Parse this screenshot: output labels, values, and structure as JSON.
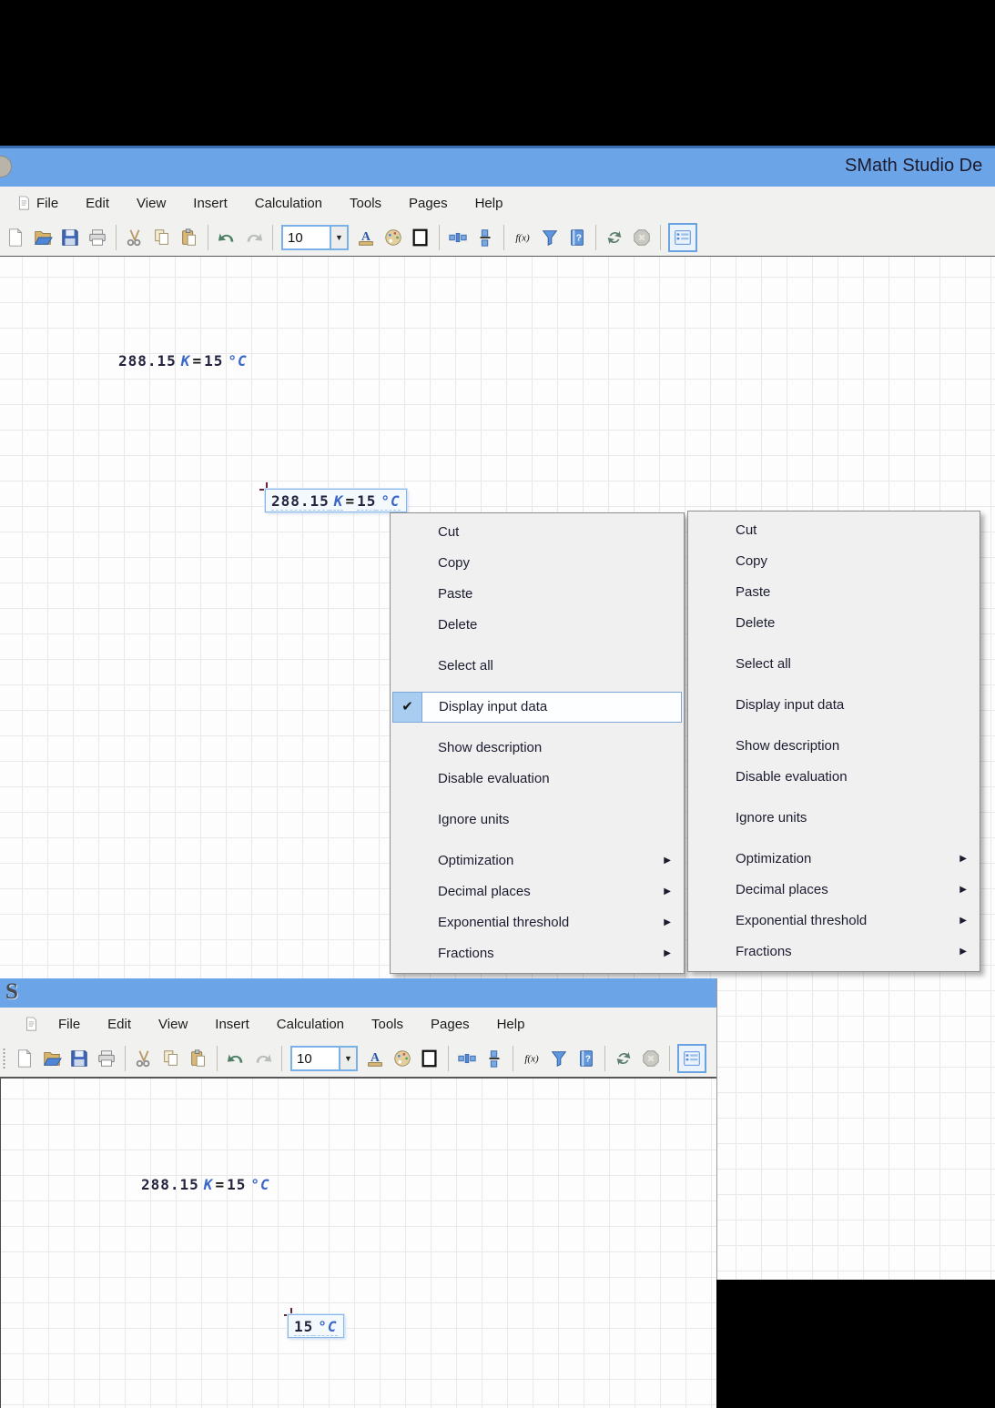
{
  "window1": {
    "title": "SMath Studio De",
    "menus": [
      "File",
      "Edit",
      "View",
      "Insert",
      "Calculation",
      "Tools",
      "Pages",
      "Help"
    ]
  },
  "window2": {
    "logo": "S",
    "menus": [
      "File",
      "Edit",
      "View",
      "Insert",
      "Calculation",
      "Tools",
      "Pages",
      "Help"
    ]
  },
  "toolbar": {
    "font_size": "10",
    "dropdown_arrow": "▼",
    "items": [
      "new",
      "open",
      "save",
      "print",
      "|",
      "cut",
      "copy",
      "paste",
      "|",
      "undo",
      "redo",
      "|",
      "fontsize",
      "fontcolor",
      "palette",
      "border",
      "|",
      "units",
      "fraction",
      "|",
      "fx",
      "funnel",
      "helpbook",
      "|",
      "refresh",
      "stop",
      "|",
      "panel"
    ]
  },
  "context_menu": {
    "checkmark": "✔",
    "submenu_arrow": "▶",
    "items": [
      {
        "label": "Cut"
      },
      {
        "label": "Copy"
      },
      {
        "label": "Paste"
      },
      {
        "label": "Delete"
      },
      {
        "label": "Select all",
        "gap": true
      },
      {
        "label": "Display input data",
        "gap": true,
        "checkable": true
      },
      {
        "label": "Show description",
        "gap": true
      },
      {
        "label": "Disable evaluation"
      },
      {
        "label": "Ignore units",
        "gap": true
      },
      {
        "label": "Optimization",
        "gap": true,
        "submenu": true
      },
      {
        "label": "Decimal places",
        "submenu": true
      },
      {
        "label": "Exponential threshold",
        "submenu": true
      },
      {
        "label": "Fractions",
        "submenu": true
      }
    ],
    "menu1_checked_item": "Display input data",
    "menu2_checked_item": null
  },
  "worksheet": {
    "expression_full": [
      {
        "t": "288.15",
        "k": "num"
      },
      {
        "t": "K",
        "k": "unit"
      },
      {
        "t": "=",
        "k": "op"
      },
      {
        "t": "15",
        "k": "num"
      },
      {
        "t": "°C",
        "k": "unit"
      }
    ],
    "expression_short": [
      {
        "t": "15",
        "k": "num"
      },
      {
        "t": "°C",
        "k": "unit"
      }
    ]
  },
  "colors": {
    "titlebar": "#6CA4E8",
    "toolbar_bg": "#F1F1EF",
    "menu_highlight_border": "#7DA6D9",
    "menu_check_gutter": "#A9CDF0",
    "number_text": "#23233F",
    "unit_text": "#3A67C8",
    "selection_border": "#86B7E8"
  }
}
